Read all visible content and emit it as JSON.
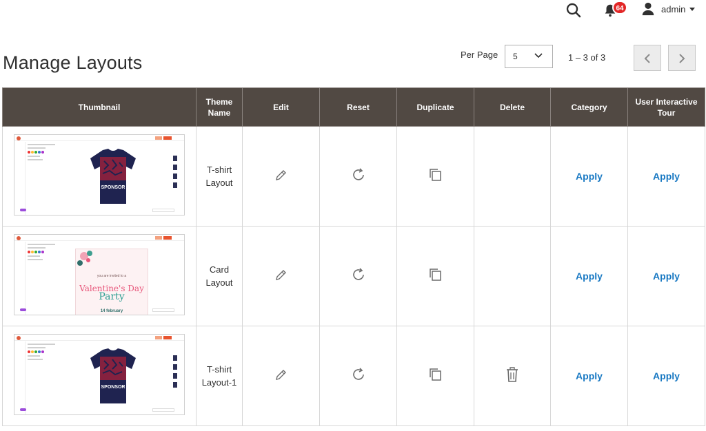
{
  "header": {
    "notification_count": "64",
    "admin_name": "admin"
  },
  "page": {
    "title": "Manage Layouts"
  },
  "pagination": {
    "per_page_label": "Per Page",
    "per_page_value": "5",
    "range_text": "1 – 3 of 3"
  },
  "table": {
    "columns": [
      "Thumbnail",
      "Theme Name",
      "Edit",
      "Reset",
      "Duplicate",
      "Delete",
      "Category",
      "User Interactive Tour"
    ],
    "rows": [
      {
        "theme_name": "T-shirt Layout",
        "thumbnail": "jersey-design",
        "thumb_text": "SPONSOR",
        "has_delete": false,
        "category_action": "Apply",
        "tour_action": "Apply"
      },
      {
        "theme_name": "Card Layout",
        "thumbnail": "valentine-card",
        "thumb_text": "Valentine's Day",
        "thumb_text2": "Party",
        "thumb_text3": "14 february",
        "thumb_text4": "you are invited to a",
        "has_delete": false,
        "category_action": "Apply",
        "tour_action": "Apply"
      },
      {
        "theme_name": "T-shirt Layout-1",
        "thumbnail": "jersey-design",
        "thumb_text": "SPONSOR",
        "has_delete": true,
        "category_action": "Apply",
        "tour_action": "Apply"
      }
    ]
  },
  "icons": {
    "search": "search-icon",
    "bell": "bell-icon",
    "user": "user-icon",
    "edit": "pencil-icon",
    "reset": "refresh-icon",
    "duplicate": "copy-icon",
    "delete": "trash-icon"
  },
  "colors": {
    "header_bg": "#514943",
    "link": "#1979c3",
    "badge": "#e22626"
  }
}
